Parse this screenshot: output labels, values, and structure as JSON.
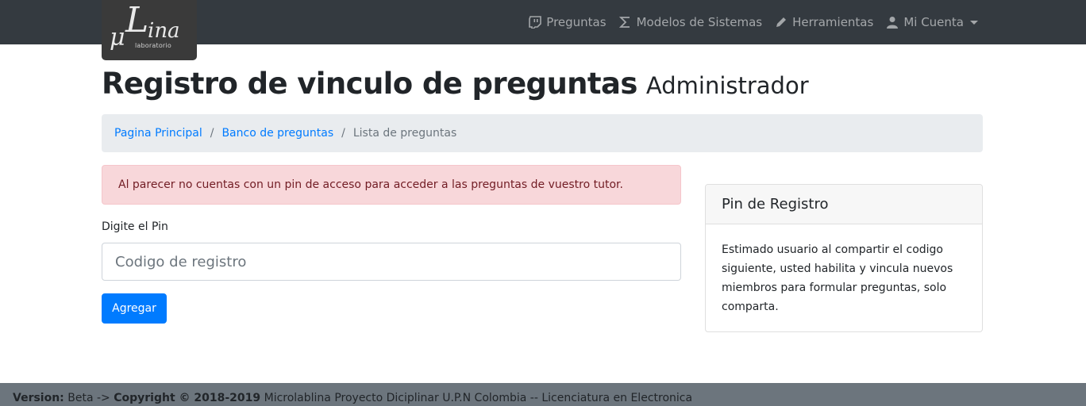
{
  "logo": {
    "mark_mu": "μ",
    "mark_l": "L",
    "mark_ina": "ina",
    "subtitle": "laboratorio"
  },
  "nav": {
    "items": [
      {
        "label": "Preguntas",
        "icon": "twitch-chat-icon"
      },
      {
        "label": "Modelos de Sistemas",
        "icon": "sigma-icon"
      },
      {
        "label": "Herramientas",
        "icon": "pencil-icon"
      },
      {
        "label": "Mi Cuenta",
        "icon": "user-icon"
      }
    ]
  },
  "page": {
    "title": "Registro de vinculo de preguntas",
    "subtitle": "Administrador"
  },
  "breadcrumb": {
    "items": [
      "Pagina Principal",
      "Banco de preguntas",
      "Lista de preguntas"
    ],
    "separator": "/"
  },
  "alert": {
    "message": "Al parecer no cuentas con un pin de acceso para acceder a las preguntas de vuestro tutor."
  },
  "form": {
    "label": "Digite el Pin",
    "placeholder": "Codigo de registro",
    "value": "",
    "submit_label": "Agregar"
  },
  "card": {
    "title": "Pin de Registro",
    "body": "Estimado usuario al compartir el codigo siguiente, usted habilita y vincula nuevos miembros para formular preguntas, solo comparta."
  },
  "footer": {
    "version_label": "Version:",
    "version_value": "Beta ->",
    "copyright": "Copyright © 2018-2019",
    "text": "Microlablina Proyecto Diciplinar U.P.N Colombia -- Licenciatura en Electronica"
  },
  "colors": {
    "navbar": "#343a40",
    "primary": "#007bff",
    "alert_bg": "#f8d7da",
    "alert_text": "#721c24",
    "breadcrumb_bg": "#e9ecef",
    "footer_bg": "#6c757d"
  }
}
